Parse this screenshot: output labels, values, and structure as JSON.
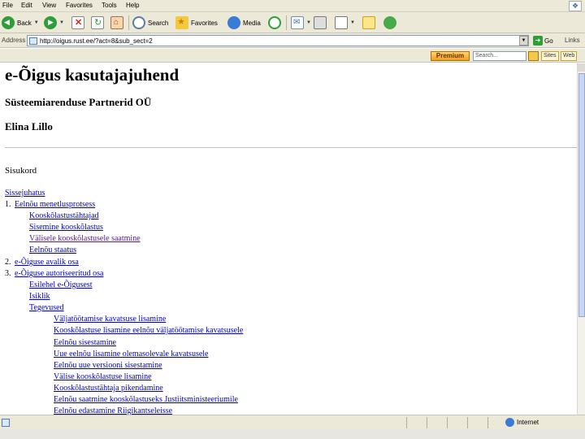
{
  "menu": [
    "File",
    "Edit",
    "View",
    "Favorites",
    "Tools",
    "Help"
  ],
  "toolbar": {
    "back": "Back",
    "search": "Search",
    "favorites": "Favorites",
    "media": "Media"
  },
  "address": {
    "label": "Address",
    "url": "http://oigus.rust.ee/?act=8&sub_sect=2",
    "go": "Go",
    "links": "Links"
  },
  "extbar": {
    "premium": "Premium",
    "search_placeholder": "Search...",
    "btn1": "Sites",
    "btn2": "Web"
  },
  "page": {
    "title": "e-Õigus kasutajajuhend",
    "company": "Süsteemiarenduse Partnerid OÜ",
    "author": "Elina Lillo",
    "toc_title": "Sisukord",
    "intro": "Sissejuhatus",
    "items": [
      {
        "num": "1.",
        "label": "Eelnõu menetlusprotsess"
      },
      {
        "label": "Kooskõlastustähtajad"
      },
      {
        "label": "Sisemine kooskõlastus"
      },
      {
        "label": "Välisele kooskõlastusele saatmine"
      },
      {
        "label": "Eelnõu staatus"
      },
      {
        "num": "2.",
        "label": "e-Õiguse avalik osa"
      },
      {
        "num": "3.",
        "label": "e-Õiguse autoriseeritud osa"
      },
      {
        "label": "Esilehel e-Õigusest"
      },
      {
        "label": "Isiklik"
      },
      {
        "label": "Tegevused"
      },
      {
        "label": "Väljatöötamise kavatsuse lisamine"
      },
      {
        "label": "Kooskõlastuse lisamine eelnõu väljatöötamise kavatsusele"
      },
      {
        "label": "Eelnõu sisestamine"
      },
      {
        "label": "Uue eelnõu lisamine olemasolevale kavatsusele"
      },
      {
        "label": "Eelnõu uue versiooni sisestamine"
      },
      {
        "label": "Välise kooskõlastuse lisamine"
      },
      {
        "label": "Kooskõlastustähtaja pikendamine"
      },
      {
        "label": "Eelnõu saatmine kooskõlastuseks Justiitsministeeriumile"
      },
      {
        "label": "Eelnõu edastamine Riigikantseleisse"
      }
    ]
  },
  "status": {
    "zone": "Internet"
  }
}
